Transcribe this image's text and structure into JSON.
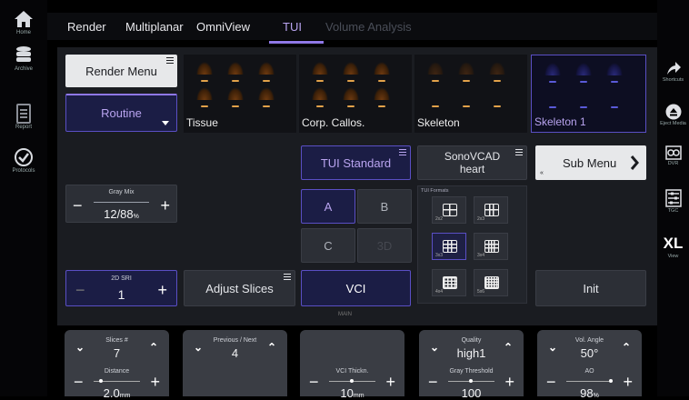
{
  "left_sidebar": {
    "items": [
      {
        "label": "Home",
        "icon": "home-icon"
      },
      {
        "label": "Archive",
        "icon": "database-icon"
      },
      {
        "label": "Report",
        "icon": "document-icon"
      },
      {
        "label": "Protocols",
        "icon": "check-circle-icon"
      }
    ]
  },
  "tabs": [
    {
      "label": "Render"
    },
    {
      "label": "Multiplanar"
    },
    {
      "label": "OmniView"
    },
    {
      "label": "TUI"
    },
    {
      "label": "Volume Analysis"
    }
  ],
  "active_tab": "TUI",
  "right_sidebar": {
    "items": [
      {
        "label": "Shortcuts",
        "icon": "share-arrow-icon"
      },
      {
        "label": "Eject Media",
        "icon": "eject-icon"
      },
      {
        "label": "DVR",
        "icon": "dvr-icon"
      },
      {
        "label": "TGC",
        "icon": "tgc-icon"
      },
      {
        "label": "View",
        "value": "XL"
      }
    ]
  },
  "panel": {
    "render_menu": "Render Menu",
    "routine": "Routine",
    "presets": [
      "Tissue",
      "Corp. Callos.",
      "Skeleton",
      "Skeleton 1"
    ],
    "selected_preset": "Skeleton 1",
    "tui_standard": "TUI Standard",
    "sonovcad_line1": "SonoVCAD",
    "sonovcad_line2": "heart",
    "sub_menu": "Sub Menu",
    "gray_mix": {
      "title": "Gray Mix",
      "value": "12/88",
      "unit": "%"
    },
    "views": [
      "A",
      "B",
      "C",
      "3D"
    ],
    "tui_formats_title": "TUI Formats",
    "tui_formats": [
      "2x2",
      "2x3",
      "3x3",
      "3x4",
      "4x4",
      "5x6"
    ],
    "selected_format": "3x3",
    "sri": {
      "title": "2D SRI",
      "value": "1"
    },
    "adjust_slices": "Adjust Slices",
    "vci": "VCI",
    "init": "Init",
    "page_indicator": "MAIN"
  },
  "bottom_controls": {
    "knobs": [
      {
        "title": "Slices #",
        "value": "7"
      },
      {
        "title": "Previous / Next",
        "value": "4"
      },
      {
        "title": "",
        "value": ""
      },
      {
        "title": "Quality",
        "value": "high1"
      },
      {
        "title": "Vol. Angle",
        "value": "50°"
      }
    ],
    "sliders": [
      {
        "title": "Distance",
        "value": "2.0",
        "unit": "mm"
      },
      {
        "title": "",
        "value": ""
      },
      {
        "title": "VCI Thickn.",
        "value": "10",
        "unit": "mm"
      },
      {
        "title": "Gray Threshold",
        "value": "100"
      },
      {
        "title": "AO",
        "value": "98",
        "unit": "%"
      }
    ]
  },
  "colors": {
    "accent": "#8f78e6",
    "selected_border": "#5a4fc4",
    "selected_fill": "#1b1d45"
  }
}
